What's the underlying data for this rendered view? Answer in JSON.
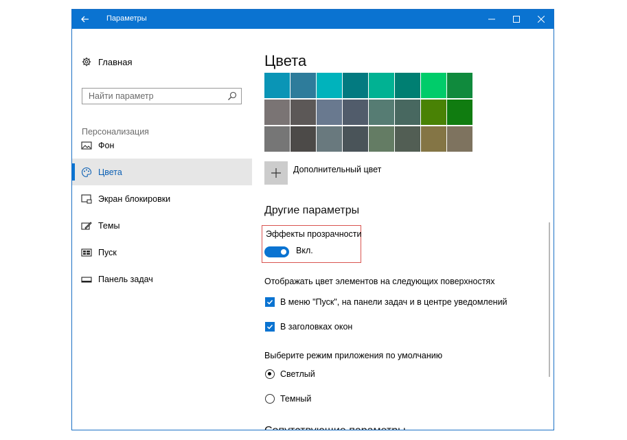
{
  "window": {
    "title": "Параметры"
  },
  "sidebar": {
    "home_label": "Главная",
    "search_placeholder": "Найти параметр",
    "section_label": "Персонализация",
    "items": [
      {
        "label": "Фон",
        "icon": "image-icon",
        "active": false
      },
      {
        "label": "Цвета",
        "icon": "palette-icon",
        "active": true
      },
      {
        "label": "Экран блокировки",
        "icon": "lock-screen-icon",
        "active": false
      },
      {
        "label": "Темы",
        "icon": "themes-icon",
        "active": false
      },
      {
        "label": "Пуск",
        "icon": "start-icon",
        "active": false
      },
      {
        "label": "Панель задач",
        "icon": "taskbar-icon",
        "active": false
      }
    ]
  },
  "main": {
    "title": "Цвета",
    "swatch_colors": [
      [
        "#0a95b6",
        "#2e7c9b",
        "#00b3bc",
        "#037a80",
        "#01b293",
        "#007f72",
        "#00cc6a",
        "#108a3d"
      ],
      [
        "#7a7474",
        "#5c5857",
        "#69798f",
        "#515c6b",
        "#567c73",
        "#486860",
        "#498205",
        "#107c10"
      ],
      [
        "#767676",
        "#4c4a48",
        "#69797e",
        "#4a5459",
        "#647c64",
        "#525e54",
        "#847545",
        "#7e735f"
      ]
    ],
    "custom_color_label": "Дополнительный цвет",
    "other_heading": "Другие параметры",
    "transparency_label": "Эффекты прозрачности",
    "transparency_state": "Вкл.",
    "surfaces_label": "Отображать цвет элементов на следующих поверхностях",
    "surface_options": [
      {
        "label": "В меню \"Пуск\", на панели задач и в центре уведомлений",
        "checked": true
      },
      {
        "label": "В заголовках окон",
        "checked": true
      }
    ],
    "app_mode_label": "Выберите режим приложения по умолчанию",
    "mode_options": [
      {
        "label": "Светлый",
        "selected": true
      },
      {
        "label": "Темный",
        "selected": false
      }
    ],
    "related_heading": "Сопутствующие параметры"
  },
  "accent_color": "#0a73d1",
  "highlight_color": "#d9534f"
}
